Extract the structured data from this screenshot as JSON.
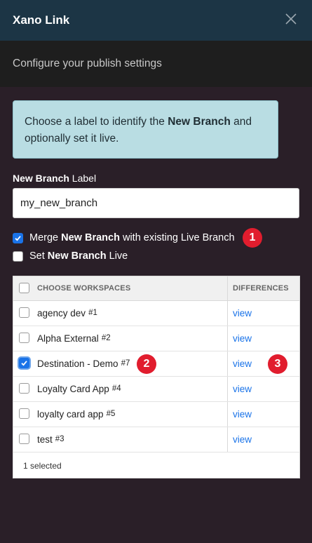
{
  "header": {
    "title": "Xano Link",
    "close_icon": "close-icon"
  },
  "subheader": {
    "text": "Configure your publish settings"
  },
  "info": {
    "text_before": "Choose a label to identify the ",
    "text_bold": "New Branch",
    "text_after": " and optionally set it live."
  },
  "label_field": {
    "label_bold": "New Branch",
    "label_rest": " Label",
    "value": "my_new_branch"
  },
  "options": [
    {
      "pre": "Merge ",
      "bold": "New Branch",
      "post": " with existing Live Branch",
      "checked": true
    },
    {
      "pre": "Set ",
      "bold": "New Branch",
      "post": " Live",
      "checked": false
    }
  ],
  "table": {
    "header_workspaces": "CHOOSE WORKSPACES",
    "header_differences": "DIFFERENCES",
    "rows": [
      {
        "name": "agency dev",
        "num": "#1",
        "checked": false,
        "link": "view"
      },
      {
        "name": "Alpha External",
        "num": "#2",
        "checked": false,
        "link": "view"
      },
      {
        "name": "Destination - Demo",
        "num": "#7",
        "checked": true,
        "link": "view"
      },
      {
        "name": "Loyalty Card App",
        "num": "#4",
        "checked": false,
        "link": "view"
      },
      {
        "name": "loyalty card app",
        "num": "#5",
        "checked": false,
        "link": "view"
      },
      {
        "name": "test",
        "num": "#3",
        "checked": false,
        "link": "view"
      }
    ],
    "footer": "1 selected"
  },
  "badges": [
    "1",
    "2",
    "3"
  ],
  "colors": {
    "header_bg": "#1c3545",
    "accent": "#1a73e8",
    "badge": "#e11d2e",
    "info_bg": "#b9dde3"
  }
}
